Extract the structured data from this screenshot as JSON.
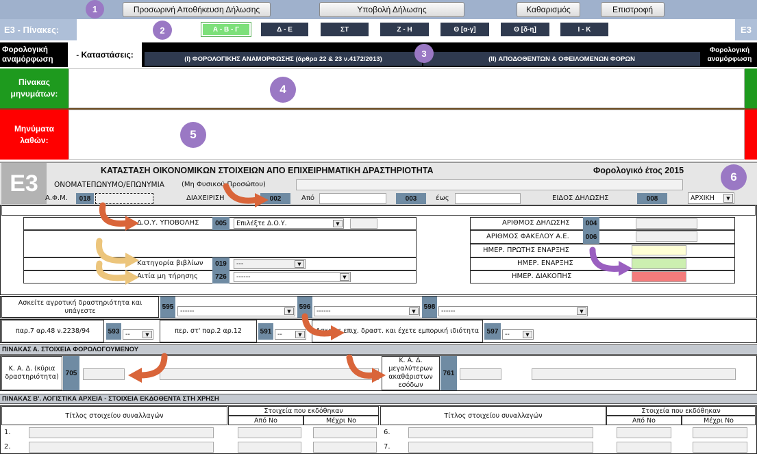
{
  "topbar": {
    "buttons": [
      "Προσωρινή Αποθήκευση Δήλωσης",
      "Υποβολή Δήλωσης",
      "Καθαρισμός",
      "Επιστροφή"
    ]
  },
  "badges": [
    "1",
    "2",
    "3",
    "4",
    "5",
    "6"
  ],
  "tabsbar": {
    "left_caption": "Ε3  - Πίνακες:",
    "right_caption": "Ε3",
    "tabs": [
      "Α - Β - Γ",
      "Δ - Ε",
      "ΣΤ",
      "Ζ - Η",
      "Θ [α-γ]",
      "Θ [δ-η]",
      "Ι - Κ"
    ],
    "active_tab": "Α - Β - Γ"
  },
  "statusbar": {
    "left_label": "Φορολογική αναμόρφωση",
    "states_label": "- Καταστάσεις:",
    "state_buttons": [
      "(I) ΦΟΡΟΛΟΓΙΚΗΣ ΑΝΑΜΟΡΦΩΣΗΣ (άρθρα 22 & 23 ν.4172/2013)",
      "(II) ΑΠΟΔΟΘΕΝΤΩΝ & ΟΦΕΙΛΟΜΕΝΩΝ ΦΟΡΩΝ"
    ],
    "right_label": "Φορολογική αναμόρφωση"
  },
  "messages": {
    "info_label": "Πίνακας μηνυμάτων:",
    "error_label": "Μηνύματα λαθών:"
  },
  "form": {
    "logo_text": "E3",
    "title": "ΚΑΤΑΣΤΑΣΗ ΟΙΚΟΝΟΜΙΚΩΝ ΣΤΟΙΧΕΙΩΝ ΑΠΟ ΕΠΙΧΕΙΡΗΜΑΤΙΚΗ ΔΡΑΣΤΗΡΙΟΤΗΤΑ",
    "tax_year": "Φορολογικό έτος 2015",
    "name_label": "ΟΝΟΜΑΤΕΠΩΝΥΜΟ/ΕΠΩΝΥΜΙΑ",
    "name_note": "(Μη Φυσικού Προσώπου)",
    "afm_label": "Α.Φ.Μ.",
    "afm_code": "018",
    "period_label": "ΔΙΑΧΕΙΡΙΣΗ",
    "period_code": "002",
    "from_label": "Από",
    "to_code": "003",
    "to_label": "έως",
    "decl_type_label": "ΕΙΔΟΣ ΔΗΛΩΣΗΣ",
    "decl_type_code": "008",
    "decl_type_value": "ΑΡΧΙΚΗ",
    "doy_label": "Δ.Ο.Υ. ΥΠΟΒΟΛΗΣ",
    "doy_code": "005",
    "doy_select": "Επιλέξτε Δ.Ο.Υ.",
    "books_label": "Κατηγορία βιβλίων",
    "books_code": "019",
    "books_value": "---",
    "reason_label": "Αιτία μη τήρησης",
    "reason_code": "726",
    "reason_value": "------",
    "decl_no_label": "ΑΡΙΘΜΟΣ ΔΗΛΩΣΗΣ",
    "decl_no_code": "004",
    "file_no_label": "ΑΡΙΘΜΟΣ ΦΑΚΕΛΟΥ Α.Ε.",
    "file_no_code": "006",
    "first_start_label": "ΗΜΕΡ. ΠΡΩΤΗΣ ΕΝΑΡΞΗΣ",
    "start_label": "ΗΜΕΡ. ΕΝΑΡΞΗΣ",
    "stop_label": "ΗΜΕΡ. ΔΙΑΚΟΠΗΣ",
    "agri_label": "Ασκείτε αγροτική δραστηριότητα και υπάγεστε",
    "agri_codes": [
      "595",
      "596",
      "598"
    ],
    "agri_values": [
      "------",
      "------",
      "------"
    ],
    "par7_label": "παρ.7 αρ.48 ν.2238/94",
    "par7_code": "593",
    "par7_value": "--",
    "per_label": "περ. στ' παρ.2 αρ.12",
    "per_code": "591",
    "per_value": "--",
    "trade_label": "Ασκείτε επιχ. δραστ. και έχετε εμπορική ιδιότητα",
    "trade_code": "597",
    "trade_value": "--",
    "section_a": "ΠΙΝΑΚΑΣ Α. ΣΤΟΙΧΕΙΑ ΦΟΡΟΛΟΓΟΥΜΕΝΟΥ",
    "kad_main_label": "Κ. Α. Δ. (κύρια δραστηριότητα)",
    "kad_main_code": "705",
    "kad_top_label": "Κ. Α. Δ. μεγαλύτερων ακαθάριστων εσόδων",
    "kad_top_code": "761",
    "section_b": "ΠΙΝΑΚΑΣ Β'. ΛΟΓΙΣΤΙΚΑ ΑΡΧΕΙΑ - ΣΤΟΙΧΕΙΑ ΕΚΔΟΘΕΝΤΑ ΣΤΗ ΧΡΗΣΗ",
    "col_title": "Τίτλος στοιχείου συναλλαγών",
    "col_issued": "Στοιχεία που εκδόθηκαν",
    "col_from": "Από Νο",
    "col_to": "Μέχρι Νο",
    "rows_left": [
      "1.",
      "2."
    ],
    "rows_right": [
      "6.",
      "7."
    ]
  },
  "colors": {
    "topbar": "#9fb1cc",
    "tab_active": "#7de07a",
    "tab": "#2f3a4f",
    "info": "#1e9a1e",
    "error": "#ff0000",
    "code": "#6f8ba3",
    "arrow_red": "#d9653a",
    "arrow_yellow": "#ecc57c",
    "arrow_purple": "#9a5fc0"
  }
}
